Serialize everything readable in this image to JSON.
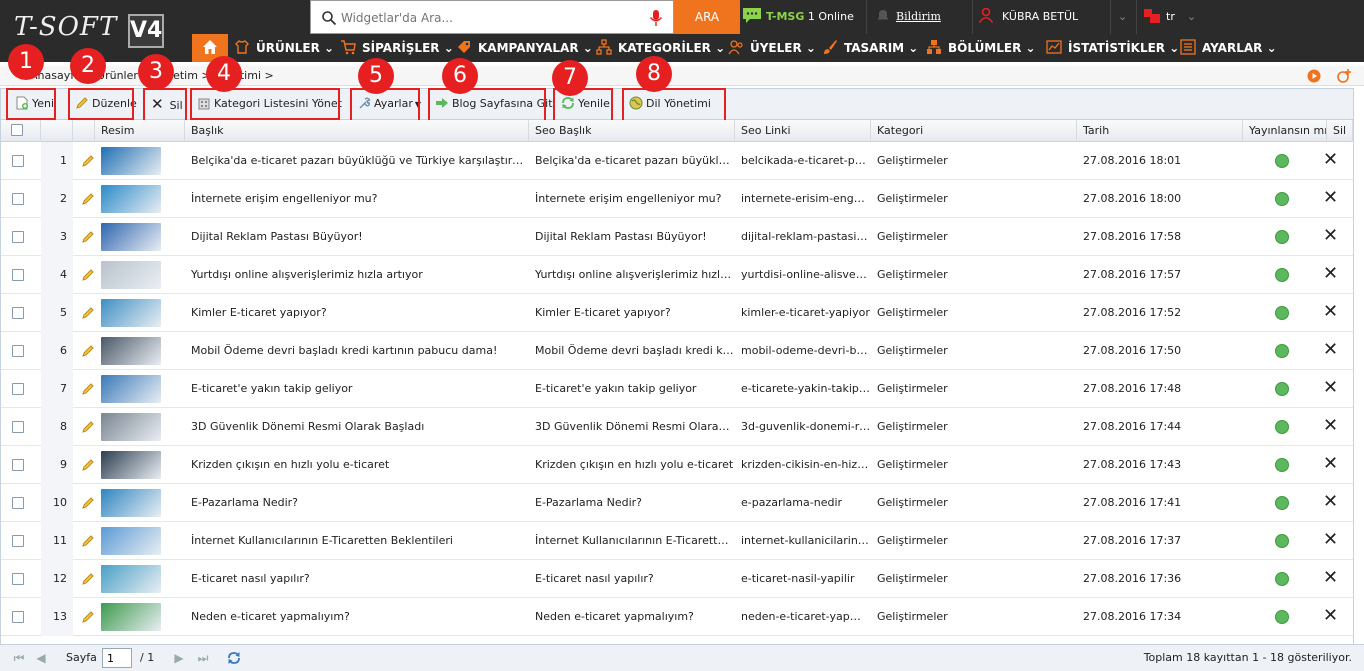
{
  "header": {
    "logo_text": "T-SOFT",
    "logo_version": "V4",
    "search_placeholder": "Widgetlar'da Ara...",
    "search_button": "ARA",
    "tmsg_label": "T-MSG",
    "tmsg_status": "1 Online",
    "notification_label": "Bildirim",
    "user_name": "KÜBRA BETÜL ALPAT",
    "language": "tr"
  },
  "nav": {
    "items": [
      "ÜRÜNLER",
      "SİPARİŞLER",
      "KAMPANYALAR",
      "KATEGORİLER",
      "ÜYELER",
      "TASARIM",
      "BÖLÜMLER",
      "İSTATİSTİKLER",
      "AYARLAR"
    ]
  },
  "breadcrumb": "Anasayfa > Ürünler > Yönetim > Yönetimi >",
  "toolbar": {
    "new": "Yeni",
    "edit": "Düzenle",
    "delete": "Sil",
    "category_list": "Kategori Listesini Yönet",
    "settings": "Ayarlar",
    "blog_page": "Blog Sayfasına Git",
    "refresh": "Yenile",
    "language_mgmt": "Dil Yönetimi"
  },
  "badges": [
    "1",
    "2",
    "3",
    "4",
    "5",
    "6",
    "7",
    "8"
  ],
  "grid": {
    "columns": [
      "Resim",
      "Başlık",
      "Seo Başlık",
      "Seo Linki",
      "Kategori",
      "Tarih",
      "Yayınlansın mı?",
      "Sil"
    ],
    "rows": [
      {
        "num": "1",
        "title": "Belçika'da e-ticaret pazarı büyüklüğü ve Türkiye karşılaştırması",
        "seo_title": "Belçika'da e-ticaret pazarı büyüklüğü v...",
        "seo_link": "belcikada-e-ticaret-paz...",
        "category": "Geliştirmeler",
        "date": "27.08.2016 18:01"
      },
      {
        "num": "2",
        "title": "İnternete erişim engelleniyor mu?",
        "seo_title": "İnternete erişim engelleniyor mu?",
        "seo_link": "internete-erisim-engell...",
        "category": "Geliştirmeler",
        "date": "27.08.2016 18:00"
      },
      {
        "num": "3",
        "title": "Dijital Reklam Pastası Büyüyor!",
        "seo_title": "Dijital Reklam Pastası Büyüyor!",
        "seo_link": "dijital-reklam-pastasi-b...",
        "category": "Geliştirmeler",
        "date": "27.08.2016 17:58"
      },
      {
        "num": "4",
        "title": "Yurtdışı online alışverişlerimiz hızla artıyor",
        "seo_title": "Yurtdışı online alışverişlerimiz hızla ar...",
        "seo_link": "yurtdisi-online-alisverisl...",
        "category": "Geliştirmeler",
        "date": "27.08.2016 17:57"
      },
      {
        "num": "5",
        "title": "Kimler E-ticaret yapıyor?",
        "seo_title": "Kimler E-ticaret yapıyor?",
        "seo_link": "kimler-e-ticaret-yapiyor",
        "category": "Geliştirmeler",
        "date": "27.08.2016 17:52"
      },
      {
        "num": "6",
        "title": "Mobil Ödeme devri başladı kredi kartının pabucu dama!",
        "seo_title": "Mobil Ödeme devri başladı kredi kartın...",
        "seo_link": "mobil-odeme-devri-basl...",
        "category": "Geliştirmeler",
        "date": "27.08.2016 17:50"
      },
      {
        "num": "7",
        "title": "E-ticaret'e yakın takip geliyor",
        "seo_title": "E-ticaret'e yakın takip geliyor",
        "seo_link": "e-ticarete-yakin-takip-g...",
        "category": "Geliştirmeler",
        "date": "27.08.2016 17:48"
      },
      {
        "num": "8",
        "title": "3D Güvenlik Dönemi Resmi Olarak Başladı",
        "seo_title": "3D Güvenlik Dönemi Resmi Olarak Baş...",
        "seo_link": "3d-guvenlik-donemi-res...",
        "category": "Geliştirmeler",
        "date": "27.08.2016 17:44"
      },
      {
        "num": "9",
        "title": "Krizden çıkışın en hızlı yolu e-ticaret",
        "seo_title": "Krizden çıkışın en hızlı yolu e-ticaret",
        "seo_link": "krizden-cikisin-en-hizli-y...",
        "category": "Geliştirmeler",
        "date": "27.08.2016 17:43"
      },
      {
        "num": "10",
        "title": "E-Pazarlama Nedir?",
        "seo_title": "E-Pazarlama Nedir?",
        "seo_link": "e-pazarlama-nedir",
        "category": "Geliştirmeler",
        "date": "27.08.2016 17:41"
      },
      {
        "num": "11",
        "title": "İnternet Kullanıcılarının E-Ticaretten Beklentileri",
        "seo_title": "İnternet Kullanıcılarının E-Ticaretten B...",
        "seo_link": "internet-kullanicilarinin...",
        "category": "Geliştirmeler",
        "date": "27.08.2016 17:37"
      },
      {
        "num": "12",
        "title": "E-ticaret nasıl yapılır?",
        "seo_title": "E-ticaret nasıl yapılır?",
        "seo_link": "e-ticaret-nasil-yapilir",
        "category": "Geliştirmeler",
        "date": "27.08.2016 17:36"
      },
      {
        "num": "13",
        "title": "Neden e-ticaret yapmalıyım?",
        "seo_title": "Neden e-ticaret yapmalıyım?",
        "seo_link": "neden-e-ticaret-yapmal...",
        "category": "Geliştirmeler",
        "date": "27.08.2016 17:34"
      }
    ]
  },
  "footer": {
    "page_label": "Sayfa",
    "page_value": "1",
    "page_total": "/ 1",
    "summary": "Toplam 18 kayıttan 1 - 18 gösteriliyor."
  },
  "colors": {
    "header_bg": "#2b2b2b",
    "accent": "#f0731e",
    "highlight": "#e62020",
    "publish_green": "#5cb85c"
  }
}
